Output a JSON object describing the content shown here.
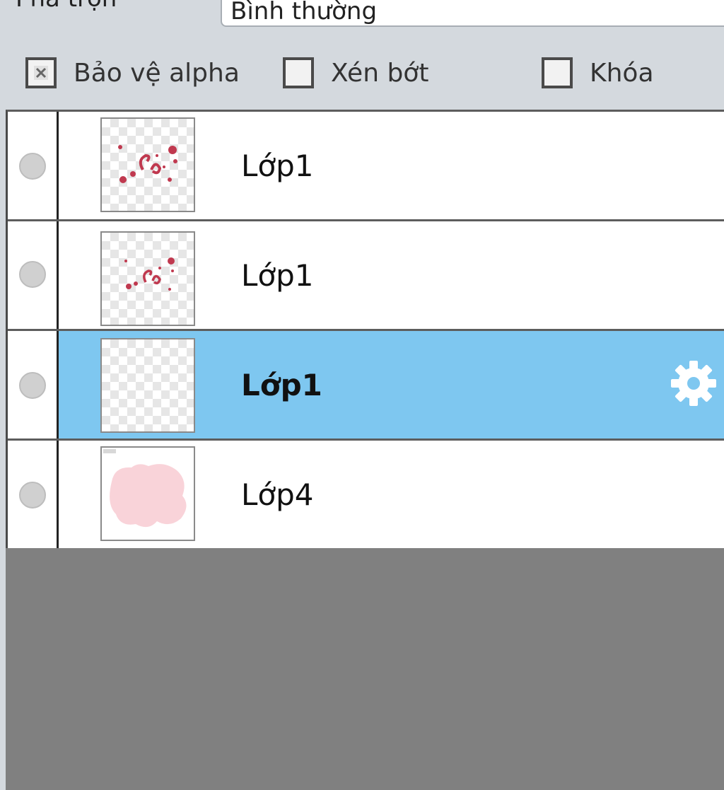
{
  "blend": {
    "label": "Pha trộn",
    "value": "Bình thường"
  },
  "options": [
    {
      "label": "Bảo vệ alpha",
      "checked": true
    },
    {
      "label": "Xén bớt",
      "checked": false
    },
    {
      "label": "Khóa",
      "checked": false
    }
  ],
  "layers": [
    {
      "name": "Lớp1",
      "thumbnail": "red-sketch",
      "selected": false
    },
    {
      "name": "Lớp1",
      "thumbnail": "red-sketch",
      "selected": false
    },
    {
      "name": "Lớp1",
      "thumbnail": "transparent",
      "selected": true
    },
    {
      "name": "Lớp4",
      "thumbnail": "pink-blob",
      "selected": false
    }
  ],
  "colors": {
    "selected_row": "#7ec7f0",
    "panel_bg": "#d4d9de",
    "empty_area": "#808080",
    "sketch_red": "#c0394f",
    "blob_pink": "#f9d3d9"
  },
  "icons": {
    "visibility": "visibility-dot-icon",
    "settings": "gear-icon"
  }
}
